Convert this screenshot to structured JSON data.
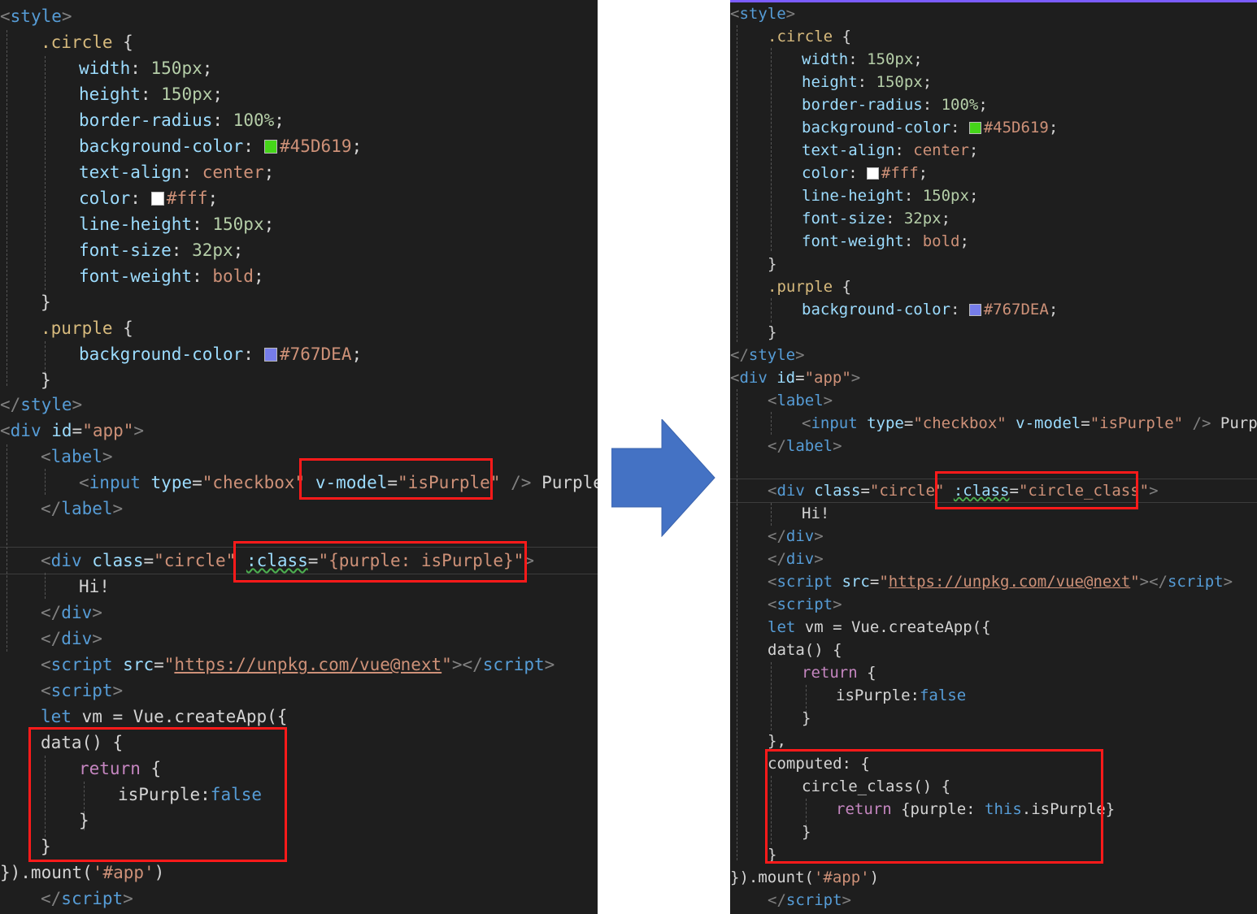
{
  "left_panel": {
    "css": {
      "style_open": "style",
      "circle_selector": ".circle",
      "width_prop": "width",
      "width_val": "150px",
      "height_prop": "height",
      "height_val": "150px",
      "radius_prop": "border-radius",
      "radius_val": "100%",
      "bg_prop": "background-color",
      "bg_val": "#45D619",
      "align_prop": "text-align",
      "align_val": "center",
      "color_prop": "color",
      "color_val": "#fff",
      "lh_prop": "line-height",
      "lh_val": "150px",
      "fs_prop": "font-size",
      "fs_val": "32px",
      "fw_prop": "font-weight",
      "fw_val": "bold",
      "purple_selector": ".purple",
      "purple_bg_prop": "background-color",
      "purple_bg_val": "#767DEA",
      "style_close": "style"
    },
    "html": {
      "div_tag": "div",
      "id_attr": "id",
      "id_val": "\"app\"",
      "label_tag": "label",
      "input_tag": "input",
      "type_attr": "type",
      "type_val": "\"checkbox\"",
      "vmodel_attr": "v-model",
      "vmodel_val": "\"isPurple\"",
      "purple_text": "Purple",
      "class_attr": "class",
      "class_val": "\"circle\"",
      "bind_attr": ":class",
      "bind_val": "\"{purple: isPurple}\"",
      "hi_text": "Hi!",
      "script_tag": "script",
      "src_attr": "src",
      "src_url": "https://unpkg.com/vue@next"
    },
    "js": {
      "let_kw": "let",
      "vm_expr": " vm = Vue.createApp({",
      "data_fn": "data() {",
      "return_kw": "return",
      "return_brace": " {",
      "is_purple_key": "isPurple:",
      "false_kw": "false",
      "mount_call": "}).mount(",
      "mount_arg": "'#app'",
      "mount_close": ")"
    }
  },
  "right_panel": {
    "css": {
      "style_open": "style",
      "circle_selector": ".circle",
      "width_prop": "width",
      "width_val": "150px",
      "height_prop": "height",
      "height_val": "150px",
      "radius_prop": "border-radius",
      "radius_val": "100%",
      "bg_prop": "background-color",
      "bg_val": "#45D619",
      "align_prop": "text-align",
      "align_val": "center",
      "color_prop": "color",
      "color_val": "#fff",
      "lh_prop": "line-height",
      "lh_val": "150px",
      "fs_prop": "font-size",
      "fs_val": "32px",
      "fw_prop": "font-weight",
      "fw_val": "bold",
      "purple_selector": ".purple",
      "purple_bg_prop": "background-color",
      "purple_bg_val": "#767DEA",
      "style_close": "style"
    },
    "html": {
      "div_tag": "div",
      "id_attr": "id",
      "id_val": "\"app\"",
      "label_tag": "label",
      "input_tag": "input",
      "type_attr": "type",
      "type_val": "\"checkbox\"",
      "vmodel_attr": "v-model",
      "vmodel_val": "\"isPurple\"",
      "purple_text": "Purple",
      "class_attr": "class",
      "class_val": "\"circle\"",
      "bind_attr": ":class",
      "bind_val": "\"circle_class\"",
      "hi_text": "Hi!",
      "script_tag": "script",
      "src_attr": "src",
      "src_url": "https://unpkg.com/vue@next"
    },
    "js": {
      "let_kw": "let",
      "vm_expr": " vm = Vue.createApp({",
      "data_fn": "data() {",
      "return_kw": "return",
      "return_brace": " {",
      "is_purple_key": "isPurple:",
      "false_kw": "false",
      "close_comma": "},",
      "computed_key": "computed: {",
      "circle_class_fn": "circle_class() {",
      "return_obj_open": " {purple: ",
      "this_kw": "this",
      "return_obj_rest": ".isPurple}",
      "mount_call": "}).mount(",
      "mount_arg": "'#app'",
      "mount_close": ")"
    }
  },
  "colors": {
    "editor_bg": "#1e1e1e",
    "highlight_box": "#ff1a1a",
    "arrow_fill": "#4472c4",
    "green_swatch": "#45D619",
    "white_swatch": "#fff",
    "purple_swatch": "#767DEA"
  },
  "icons": {
    "arrow": "right-arrow-icon"
  }
}
